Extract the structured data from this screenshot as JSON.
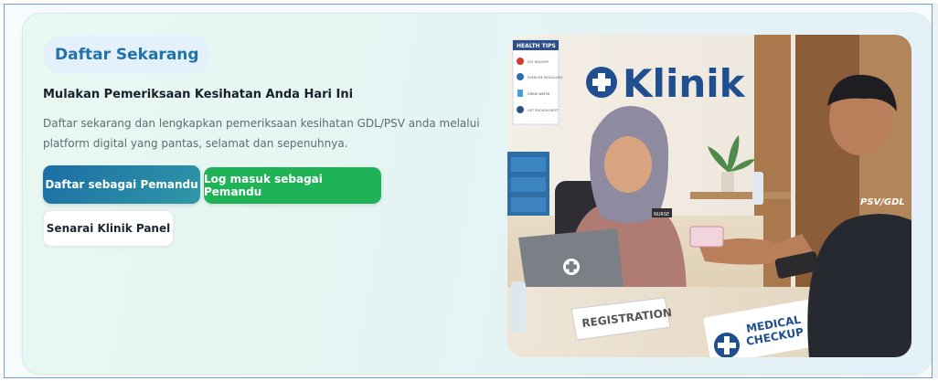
{
  "section": {
    "badge": "Daftar Sekarang",
    "headline": "Mulakan Pemeriksaan Kesihatan Anda Hari Ini",
    "description": "Daftar sekarang dan lengkapkan pemeriksaan kesihatan GDL/PSV anda melalui platform digital yang pantas, selamat dan sepenuhnya."
  },
  "buttons": {
    "register_driver": "Daftar sebagai Pemandu",
    "login_driver": "Log masuk sebagai Pemandu",
    "panel_clinics": "Senarai Klinik Panel"
  },
  "image": {
    "clinic_sign": "Klinik",
    "health_tips_title": "HEALTH TIPS",
    "health_tips_items": [
      "EAT HEALTHY",
      "EXERCISE REGULARLY",
      "DRINK WATER",
      "GET ENOUGH REST"
    ],
    "registration_sign": "REGISTRATION",
    "medical_checkup_line1": "MEDICAL",
    "medical_checkup_line2": "CHECKUP",
    "shirt_text": "PSV/GDL",
    "nametag": "NURSE"
  },
  "colors": {
    "primary": "#1b6da6",
    "success": "#1fb257",
    "badge_text": "#1f73a8"
  }
}
